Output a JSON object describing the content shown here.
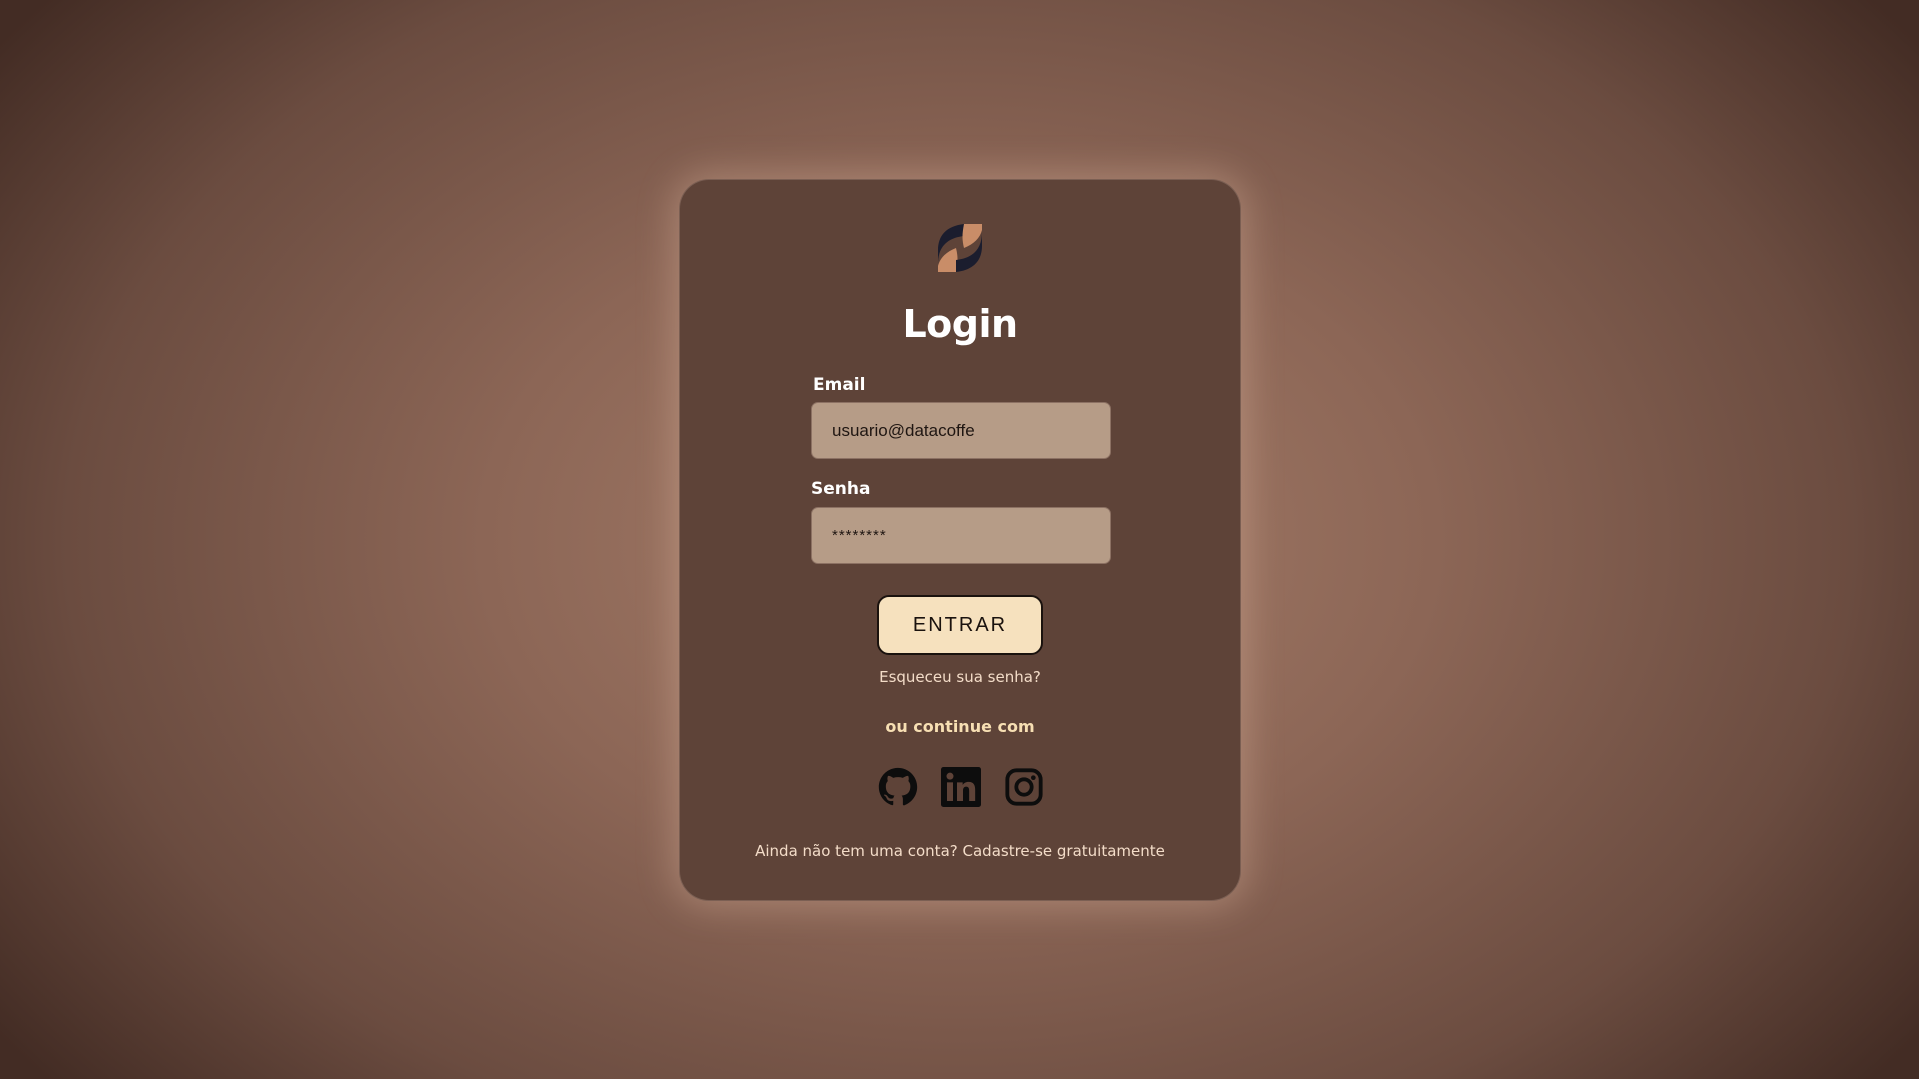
{
  "page": {
    "title": "Login",
    "colors": {
      "background": "#8c6656",
      "card": "#5e4338",
      "input": "#b69c87",
      "button": "#f6e1be",
      "accent_text": "#f7dfb3",
      "logo_dark": "#1b1d2e",
      "logo_light": "#c98d68"
    }
  },
  "logo": {
    "icon": "double-s-logo-icon"
  },
  "form": {
    "email_label": "Email",
    "email_value": "usuario@datacoffe",
    "password_label": "Senha",
    "password_value": "********",
    "submit_label": "ENTRAR",
    "forgot_label": "Esqueceu sua senha?"
  },
  "social": {
    "heading": "ou continue com",
    "items": [
      {
        "name": "GitHub",
        "icon": "github-icon"
      },
      {
        "name": "LinkedIn",
        "icon": "linkedin-icon"
      },
      {
        "name": "Instagram",
        "icon": "instagram-icon"
      }
    ]
  },
  "signup": {
    "prompt": "Ainda não tem uma conta?",
    "link": "Cadastre-se gratuitamente"
  }
}
